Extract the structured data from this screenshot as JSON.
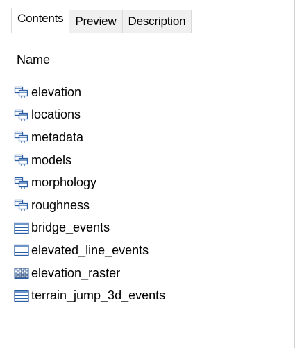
{
  "tabs": [
    {
      "label": "Contents",
      "active": true
    },
    {
      "label": "Preview",
      "active": false
    },
    {
      "label": "Description",
      "active": false
    }
  ],
  "column_header": "Name",
  "items": [
    {
      "label": "elevation",
      "icon": "feature-dataset-icon"
    },
    {
      "label": "locations",
      "icon": "feature-dataset-icon"
    },
    {
      "label": "metadata",
      "icon": "feature-dataset-icon"
    },
    {
      "label": "models",
      "icon": "feature-dataset-icon"
    },
    {
      "label": "morphology",
      "icon": "feature-dataset-icon"
    },
    {
      "label": "roughness",
      "icon": "feature-dataset-icon"
    },
    {
      "label": "bridge_events",
      "icon": "table-icon"
    },
    {
      "label": "elevated_line_events",
      "icon": "table-icon"
    },
    {
      "label": "elevation_raster",
      "icon": "raster-icon"
    },
    {
      "label": "terrain_jump_3d_events",
      "icon": "table-icon"
    }
  ],
  "colors": {
    "icon_blue": "#2b5fa5",
    "icon_fill": "#ffffff",
    "table_header": "#6d94c9",
    "tab_border": "#d9d9d9",
    "tab_inactive_bg": "#f0f0f0"
  }
}
